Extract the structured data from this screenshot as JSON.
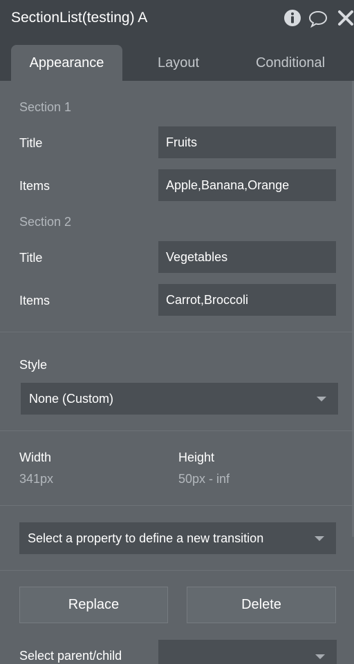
{
  "header": {
    "title": "SectionList(testing) A",
    "icons": [
      "info-icon",
      "comment-icon",
      "close-icon"
    ]
  },
  "tabs": {
    "appearance": "Appearance",
    "layout": "Layout",
    "conditional": "Conditional",
    "active": "Appearance"
  },
  "section1": {
    "heading": "Section 1",
    "title_label": "Title",
    "title_value": "Fruits",
    "items_label": "Items",
    "items_value": "Apple,Banana,Orange"
  },
  "section2": {
    "heading": "Section 2",
    "title_label": "Title",
    "title_value": "Vegetables",
    "items_label": "Items",
    "items_value": "Carrot,Broccoli"
  },
  "style": {
    "label": "Style",
    "selected": "None (Custom)"
  },
  "dimensions": {
    "width_label": "Width",
    "width_value": "341px",
    "height_label": "Height",
    "height_value": "50px - inf"
  },
  "transition": {
    "placeholder": "Select a property to define a new transition"
  },
  "actions": {
    "replace": "Replace",
    "delete": "Delete"
  },
  "parent_child": {
    "label": "Select parent/child",
    "selected": ""
  },
  "colors": {
    "panel_bg": "#5f6469",
    "header_bg": "#3f4449",
    "field_bg": "#4a4f54",
    "muted_text": "#b3b8bd"
  }
}
